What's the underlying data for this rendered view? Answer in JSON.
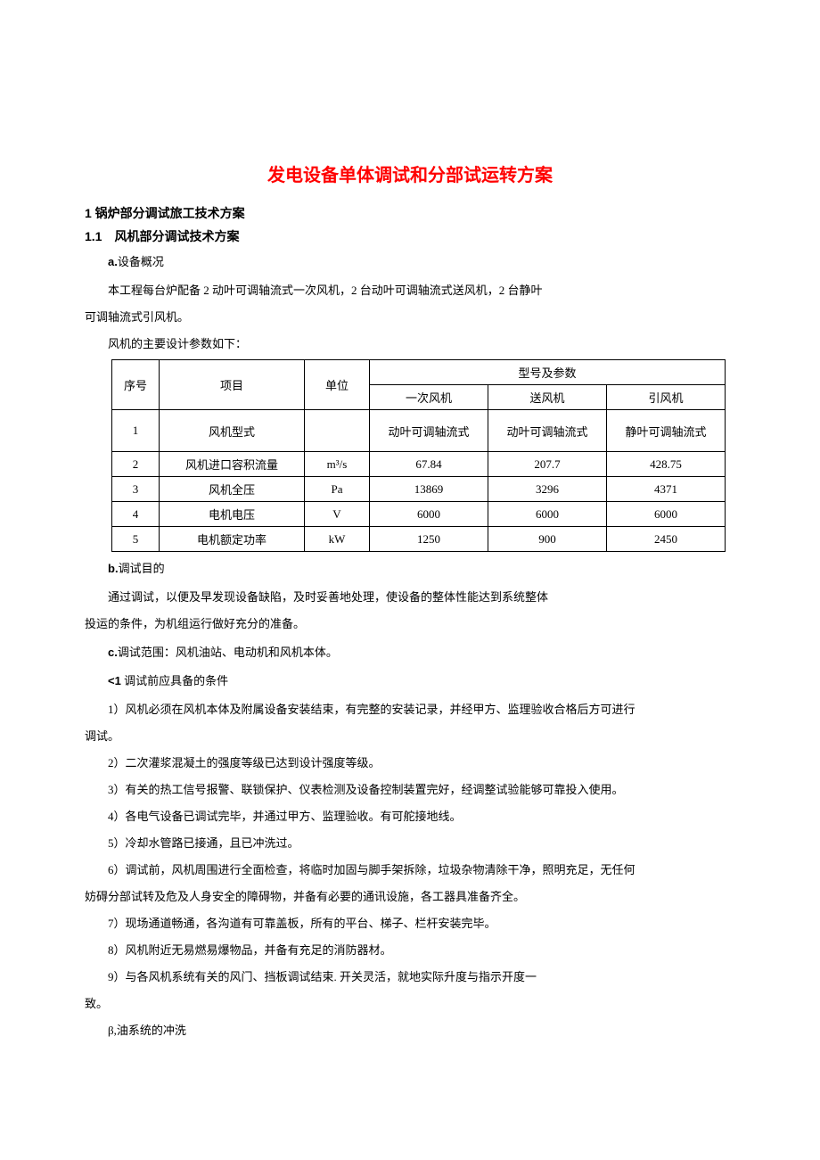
{
  "title": "发电设备单体调试和分部试运转方案",
  "h1": "1 锅炉部分调试旅工技术方案",
  "h2": "1.1　风机部分调试技术方案",
  "sec_a_label": "a.",
  "sec_a_title": "设备概况",
  "para1": "本工程每台炉配备 2 动叶可调轴流式一次风机，2 台动叶可调轴流式送风机，2 台静叶",
  "para1b": "可调轴流式引风机。",
  "para2": "风机的主要设计参数如下：",
  "table": {
    "h_seq": "序号",
    "h_item": "项目",
    "h_unit": "单位",
    "h_spec": "型号及参数",
    "h_sub1": "一次风机",
    "h_sub2": "送风机",
    "h_sub3": "引风机",
    "rows": [
      {
        "seq": "1",
        "item": "风机型式",
        "unit": "",
        "v1": "动叶可调轴流式",
        "v2": "动叶可调轴流式",
        "v3": "静叶可调轴流式"
      },
      {
        "seq": "2",
        "item": "风机进口容积流量",
        "unit": "m³/s",
        "v1": "67.84",
        "v2": "207.7",
        "v3": "428.75"
      },
      {
        "seq": "3",
        "item": "风机全压",
        "unit": "Pa",
        "v1": "13869",
        "v2": "3296",
        "v3": "4371"
      },
      {
        "seq": "4",
        "item": "电机电压",
        "unit": "V",
        "v1": "6000",
        "v2": "6000",
        "v3": "6000"
      },
      {
        "seq": "5",
        "item": "电机额定功率",
        "unit": "kW",
        "v1": "1250",
        "v2": "900",
        "v3": "2450"
      }
    ]
  },
  "sec_b_label": "b.",
  "sec_b_title": "调试目的",
  "para_b1": "通过调试，以便及早发现设备缺陷，及时妥善地处理，使设备的整体性能达到系统整体",
  "para_b1b": "投运的条件，为机组运行做好充分的准备。",
  "sec_c_label": "c.",
  "sec_c_text": "调试范围：风机油站、电动机和风机本体。",
  "sec_lt1_label": "<1",
  "sec_lt1_text": " 调试前应具备的条件",
  "items": [
    "1）风机必须在风机本体及附属设备安装结束，有完整的安装记录，并经甲方、监理验收合格后方可进行",
    "2）二次灌浆混凝土的强度等级已达到设计强度等级。",
    "3）有关的热工信号报警、联锁保护、仪表检测及设备控制装置完好，经调整试验能够可靠投入使用。",
    "4）各电气设备已调试完毕，并通过甲方、监理验收。有可舵接地线。",
    "5）冷却水管路已接通，且已冲洗过。",
    "6）调试前，风机周围进行全面检查，将临时加固与脚手架拆除，垃圾杂物清除干净，照明充足，无任何",
    "7）现场通道畅通，各沟道有可靠盖板，所有的平台、梯子、栏杆安装完毕。",
    "8）风机附近无易燃易爆物品，并备有充足的消防器材。",
    "9）与各风机系统有关的风门、挡板调试结束. 开关灵活，就地实际升度与指示开度一"
  ],
  "item1_tail": "调试。",
  "item6_tail": "妨碍分部试转及危及人身安全的障碍物，并备有必要的通讯设施，各工器具准备齐全。",
  "item9_tail": "致。",
  "beta": "β,油系统的冲洗"
}
